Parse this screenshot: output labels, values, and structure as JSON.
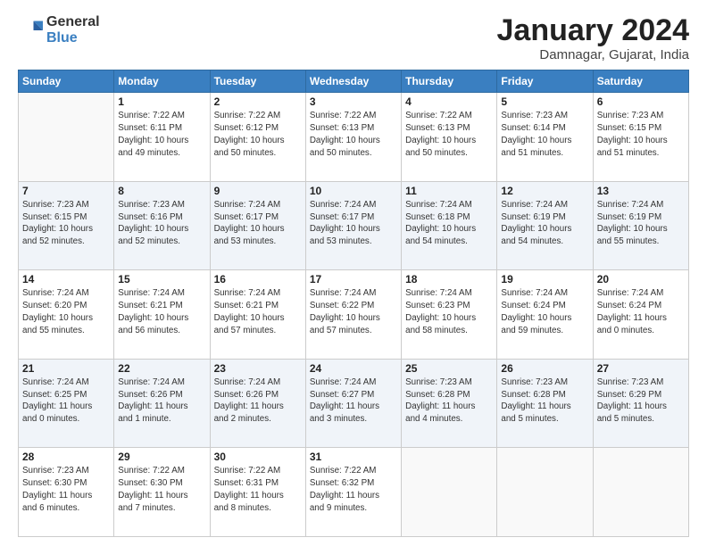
{
  "logo": {
    "general": "General",
    "blue": "Blue"
  },
  "header": {
    "month": "January 2024",
    "location": "Damnagar, Gujarat, India"
  },
  "days_of_week": [
    "Sunday",
    "Monday",
    "Tuesday",
    "Wednesday",
    "Thursday",
    "Friday",
    "Saturday"
  ],
  "weeks": [
    [
      {
        "day": "",
        "info": ""
      },
      {
        "day": "1",
        "info": "Sunrise: 7:22 AM\nSunset: 6:11 PM\nDaylight: 10 hours\nand 49 minutes."
      },
      {
        "day": "2",
        "info": "Sunrise: 7:22 AM\nSunset: 6:12 PM\nDaylight: 10 hours\nand 50 minutes."
      },
      {
        "day": "3",
        "info": "Sunrise: 7:22 AM\nSunset: 6:13 PM\nDaylight: 10 hours\nand 50 minutes."
      },
      {
        "day": "4",
        "info": "Sunrise: 7:22 AM\nSunset: 6:13 PM\nDaylight: 10 hours\nand 50 minutes."
      },
      {
        "day": "5",
        "info": "Sunrise: 7:23 AM\nSunset: 6:14 PM\nDaylight: 10 hours\nand 51 minutes."
      },
      {
        "day": "6",
        "info": "Sunrise: 7:23 AM\nSunset: 6:15 PM\nDaylight: 10 hours\nand 51 minutes."
      }
    ],
    [
      {
        "day": "7",
        "info": "Sunrise: 7:23 AM\nSunset: 6:15 PM\nDaylight: 10 hours\nand 52 minutes."
      },
      {
        "day": "8",
        "info": "Sunrise: 7:23 AM\nSunset: 6:16 PM\nDaylight: 10 hours\nand 52 minutes."
      },
      {
        "day": "9",
        "info": "Sunrise: 7:24 AM\nSunset: 6:17 PM\nDaylight: 10 hours\nand 53 minutes."
      },
      {
        "day": "10",
        "info": "Sunrise: 7:24 AM\nSunset: 6:17 PM\nDaylight: 10 hours\nand 53 minutes."
      },
      {
        "day": "11",
        "info": "Sunrise: 7:24 AM\nSunset: 6:18 PM\nDaylight: 10 hours\nand 54 minutes."
      },
      {
        "day": "12",
        "info": "Sunrise: 7:24 AM\nSunset: 6:19 PM\nDaylight: 10 hours\nand 54 minutes."
      },
      {
        "day": "13",
        "info": "Sunrise: 7:24 AM\nSunset: 6:19 PM\nDaylight: 10 hours\nand 55 minutes."
      }
    ],
    [
      {
        "day": "14",
        "info": "Sunrise: 7:24 AM\nSunset: 6:20 PM\nDaylight: 10 hours\nand 55 minutes."
      },
      {
        "day": "15",
        "info": "Sunrise: 7:24 AM\nSunset: 6:21 PM\nDaylight: 10 hours\nand 56 minutes."
      },
      {
        "day": "16",
        "info": "Sunrise: 7:24 AM\nSunset: 6:21 PM\nDaylight: 10 hours\nand 57 minutes."
      },
      {
        "day": "17",
        "info": "Sunrise: 7:24 AM\nSunset: 6:22 PM\nDaylight: 10 hours\nand 57 minutes."
      },
      {
        "day": "18",
        "info": "Sunrise: 7:24 AM\nSunset: 6:23 PM\nDaylight: 10 hours\nand 58 minutes."
      },
      {
        "day": "19",
        "info": "Sunrise: 7:24 AM\nSunset: 6:24 PM\nDaylight: 10 hours\nand 59 minutes."
      },
      {
        "day": "20",
        "info": "Sunrise: 7:24 AM\nSunset: 6:24 PM\nDaylight: 11 hours\nand 0 minutes."
      }
    ],
    [
      {
        "day": "21",
        "info": "Sunrise: 7:24 AM\nSunset: 6:25 PM\nDaylight: 11 hours\nand 0 minutes."
      },
      {
        "day": "22",
        "info": "Sunrise: 7:24 AM\nSunset: 6:26 PM\nDaylight: 11 hours\nand 1 minute."
      },
      {
        "day": "23",
        "info": "Sunrise: 7:24 AM\nSunset: 6:26 PM\nDaylight: 11 hours\nand 2 minutes."
      },
      {
        "day": "24",
        "info": "Sunrise: 7:24 AM\nSunset: 6:27 PM\nDaylight: 11 hours\nand 3 minutes."
      },
      {
        "day": "25",
        "info": "Sunrise: 7:23 AM\nSunset: 6:28 PM\nDaylight: 11 hours\nand 4 minutes."
      },
      {
        "day": "26",
        "info": "Sunrise: 7:23 AM\nSunset: 6:28 PM\nDaylight: 11 hours\nand 5 minutes."
      },
      {
        "day": "27",
        "info": "Sunrise: 7:23 AM\nSunset: 6:29 PM\nDaylight: 11 hours\nand 5 minutes."
      }
    ],
    [
      {
        "day": "28",
        "info": "Sunrise: 7:23 AM\nSunset: 6:30 PM\nDaylight: 11 hours\nand 6 minutes."
      },
      {
        "day": "29",
        "info": "Sunrise: 7:22 AM\nSunset: 6:30 PM\nDaylight: 11 hours\nand 7 minutes."
      },
      {
        "day": "30",
        "info": "Sunrise: 7:22 AM\nSunset: 6:31 PM\nDaylight: 11 hours\nand 8 minutes."
      },
      {
        "day": "31",
        "info": "Sunrise: 7:22 AM\nSunset: 6:32 PM\nDaylight: 11 hours\nand 9 minutes."
      },
      {
        "day": "",
        "info": ""
      },
      {
        "day": "",
        "info": ""
      },
      {
        "day": "",
        "info": ""
      }
    ]
  ]
}
